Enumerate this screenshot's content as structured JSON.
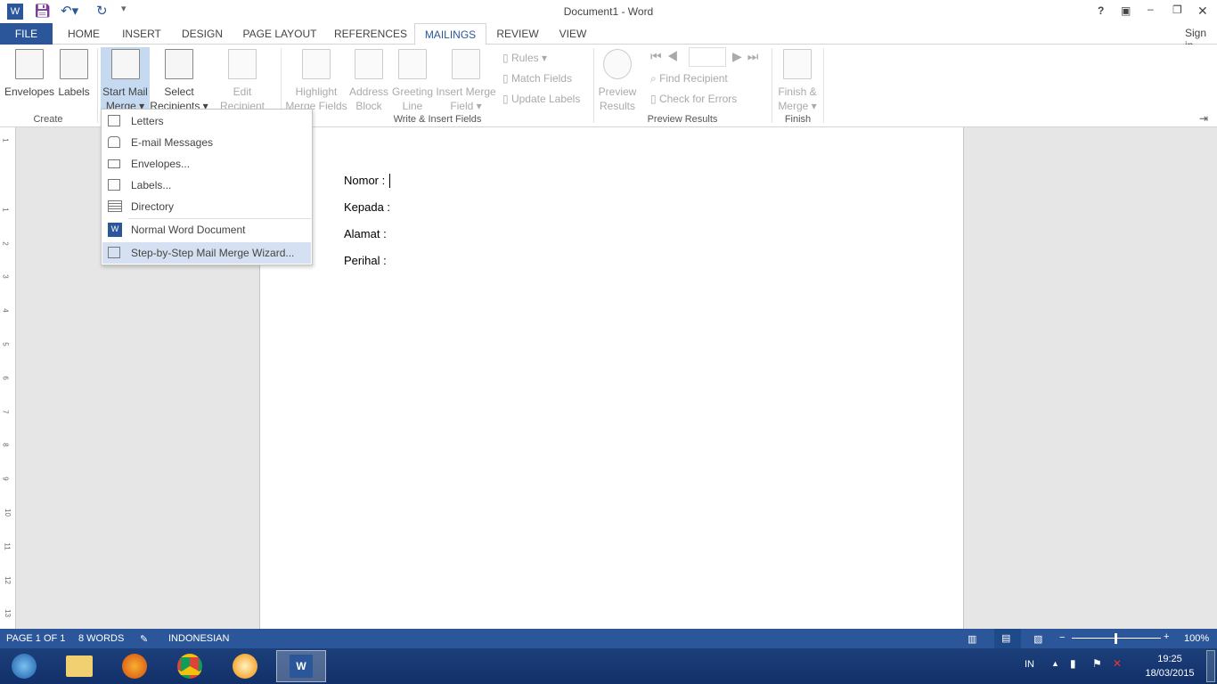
{
  "window": {
    "title": "Document1 - Word",
    "help": "?",
    "sign_in": "Sign in"
  },
  "tabs": [
    "FILE",
    "HOME",
    "INSERT",
    "DESIGN",
    "PAGE LAYOUT",
    "REFERENCES",
    "MAILINGS",
    "REVIEW",
    "VIEW"
  ],
  "active_tab": "MAILINGS",
  "ribbon": {
    "create": {
      "label": "Create",
      "envelopes": "Envelopes",
      "labels": "Labels"
    },
    "start": {
      "start_mail_merge": [
        "Start Mail",
        "Merge ▾"
      ],
      "select_recipients": [
        "Select",
        "Recipients ▾"
      ],
      "edit_recipient_list": [
        "Edit",
        "Recipient List"
      ]
    },
    "write": {
      "label": "Write & Insert Fields",
      "highlight": [
        "Highlight",
        "Merge Fields"
      ],
      "address": [
        "Address",
        "Block"
      ],
      "greeting": [
        "Greeting",
        "Line"
      ],
      "insert_field": [
        "Insert Merge",
        "Field ▾"
      ],
      "rules": "Rules ▾",
      "match_fields": "Match Fields",
      "update_labels": "Update Labels"
    },
    "preview": {
      "label": "Preview Results",
      "preview_results": [
        "Preview",
        "Results"
      ],
      "find_recipient": "Find Recipient",
      "check_errors": "Check for Errors",
      "record": ""
    },
    "finish": {
      "label": "Finish",
      "finish_merge": [
        "Finish &",
        "Merge ▾"
      ]
    }
  },
  "menu": {
    "items": [
      "Letters",
      "E-mail Messages",
      "Envelopes...",
      "Labels...",
      "Directory",
      "Normal Word Document",
      "Step-by-Step Mail Merge Wizard..."
    ],
    "highlighted": "Step-by-Step Mail Merge Wizard..."
  },
  "document": {
    "lines": [
      "Nomor  :",
      "Kepada :",
      "Alamat  :",
      "Perihal  :"
    ]
  },
  "ruler": [
    "1",
    "1",
    "2",
    "3",
    "4",
    "5",
    "6",
    "7",
    "8",
    "9",
    "10",
    "11",
    "12",
    "13"
  ],
  "status": {
    "page": "PAGE 1 OF 1",
    "words": "8 WORDS",
    "language": "INDONESIAN",
    "zoom": "100%",
    "zoom_percent": 100
  },
  "taskbar": {
    "lang": "IN",
    "time": "19:25",
    "date": "18/03/2015",
    "apps": [
      "start",
      "explorer",
      "firefox",
      "chrome",
      "media-player",
      "word"
    ]
  },
  "colors": {
    "accent": "#2b579a",
    "highlight": "#d5e1f2"
  }
}
